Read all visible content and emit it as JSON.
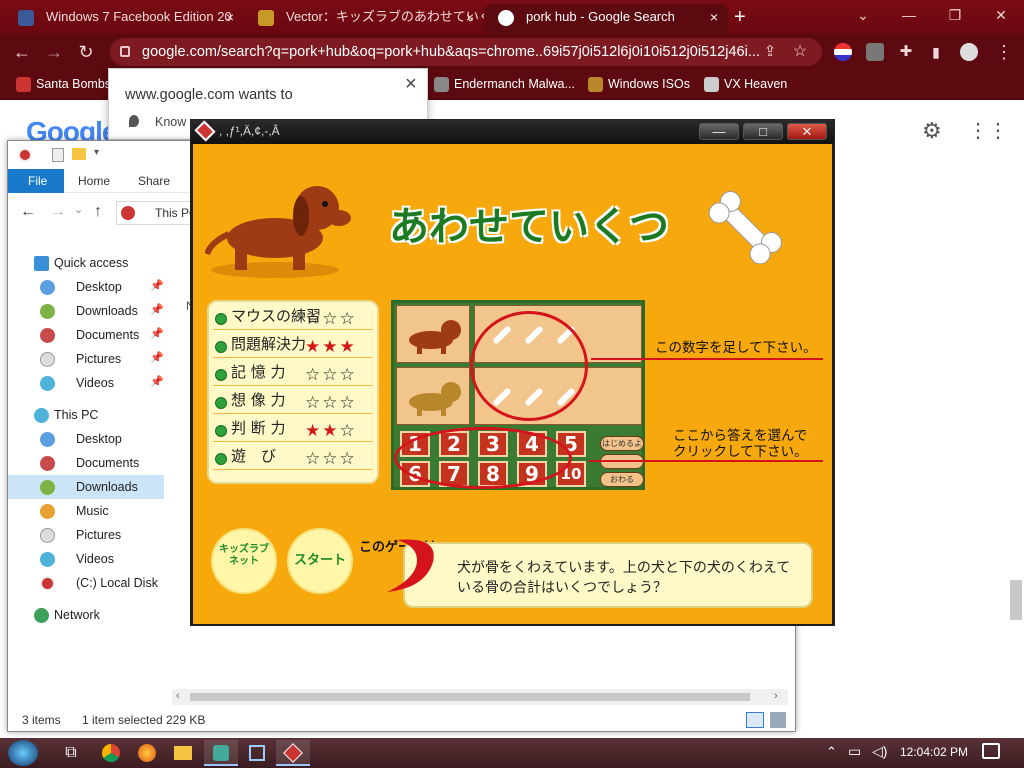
{
  "browser": {
    "tabs": [
      {
        "label": "Windows 7 Facebook Edition 20",
        "close": "×"
      },
      {
        "label": "Vector：キッズラブのあわせていくつ",
        "close": "×"
      },
      {
        "label": "pork hub - Google Search",
        "close": "×"
      }
    ],
    "new_tab": "+",
    "window_controls": {
      "chevron": "⌄",
      "minimize": "—",
      "restore": "❐",
      "close": "✕"
    },
    "url": "google.com/search?q=pork+hub&oq=pork+hub&aqs=chrome..69i57j0i512l6j0i10i512j0i512j46i...",
    "bookmarks": [
      "Santa Bombs",
      "Endermanch Malwa...",
      "Windows ISOs",
      "VX Heaven"
    ]
  },
  "permission_popup": {
    "title": "www.google.com wants to",
    "item": "Know y",
    "close": "×"
  },
  "google": {
    "logo": "Google"
  },
  "explorer": {
    "ribbon_tabs": [
      "File",
      "Home",
      "Share"
    ],
    "address": "This PC",
    "nav": {
      "quick_access": "Quick access",
      "quick_items": [
        "Desktop",
        "Downloads",
        "Documents",
        "Pictures",
        "Videos"
      ],
      "this_pc": "This PC",
      "pc_items": [
        "Desktop",
        "Documents",
        "Downloads",
        "Music",
        "Pictures",
        "Videos",
        "(C:) Local Disk"
      ],
      "network": "Network"
    },
    "column_hint": "N",
    "status": {
      "items": "3 items",
      "selected": "1 item selected",
      "size": "229 KB"
    }
  },
  "game": {
    "window_title": ", ,ƒ¹,Ä,¢,-,Â",
    "controls": {
      "minimize": "—",
      "maximize": "□",
      "close": "✕"
    },
    "title": "あわせていくつ",
    "skills": [
      {
        "label": "マウスの練習",
        "stars": [
          "☆",
          "☆",
          "☆"
        ],
        "red": 0
      },
      {
        "label": "問題解決力",
        "stars": [
          "★",
          "★",
          "★"
        ],
        "red": 3
      },
      {
        "label": "記 憶 力",
        "stars": [
          "☆",
          "☆",
          "☆"
        ],
        "red": 0
      },
      {
        "label": "想 像 力",
        "stars": [
          "☆",
          "☆",
          "☆"
        ],
        "red": 0
      },
      {
        "label": "判 断 力",
        "stars": [
          "★",
          "★",
          "☆"
        ],
        "red": 2
      },
      {
        "label": "遊　び",
        "stars": [
          "☆",
          "☆",
          "☆"
        ],
        "red": 0
      }
    ],
    "numbers": [
      "1",
      "2",
      "3",
      "4",
      "5",
      "6",
      "7",
      "8",
      "9",
      "10"
    ],
    "side_buttons": [
      "はじめるよ",
      "",
      "おわる"
    ],
    "note_add": "この数字を足して下さい。",
    "note_choose_1": "ここから答えを選んで",
    "note_choose_2": "クリックして下さい。",
    "this_game": "このゲームは・・・",
    "description_1": "犬が骨をくわえています。上の犬と下の犬のくわえて",
    "description_2": "いる骨の合計はいくつでしょう？",
    "btn_kidslove": "キッズラブネット",
    "btn_start": "スタート"
  },
  "taskbar": {
    "time": "12:04:02 PM",
    "tray_icons": [
      "chevron-up-icon",
      "network-icon",
      "volume-icon",
      "notification-icon"
    ]
  }
}
